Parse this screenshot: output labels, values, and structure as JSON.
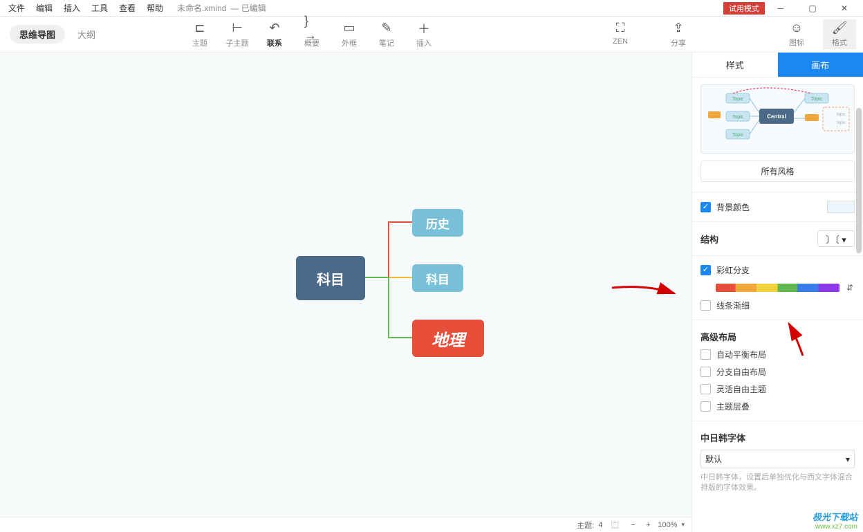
{
  "menubar": [
    "文件",
    "编辑",
    "插入",
    "工具",
    "查看",
    "帮助"
  ],
  "title": {
    "filename": "未命名.xmind",
    "status": "— 已编辑",
    "trial": "试用模式"
  },
  "viewtabs": {
    "mindmap": "思维导图",
    "outline": "大纲"
  },
  "tools": {
    "topic": "主题",
    "subtopic": "子主题",
    "relationship": "联系",
    "summary": "概要",
    "boundary": "外框",
    "note": "笔记",
    "insert": "插入",
    "zen": "ZEN",
    "share": "分享",
    "icon": "图标",
    "format": "格式"
  },
  "canvas": {
    "center": "科目",
    "children": [
      {
        "label": "历史"
      },
      {
        "label": "科目"
      },
      {
        "label": "地理"
      }
    ]
  },
  "panel": {
    "tabs": {
      "style": "样式",
      "canvas": "画布"
    },
    "preview_center": "Central",
    "preview_topic": "Topic",
    "preview_topic_small": "topic",
    "all_styles": "所有风格",
    "bg_color": "背景颜色",
    "structure": "结构",
    "rainbow": "彩虹分支",
    "line_taper": "线条渐细",
    "adv_layout": "高级布局",
    "auto_balance": "自动平衡布局",
    "free_branch": "分支自由布局",
    "flex_topic": "灵活自由主题",
    "overlap": "主题层叠",
    "cjk_font": "中日韩字体",
    "font_default": "默认",
    "cjk_desc": "中日韩字体，设置后单独优化与西文字体混合排版的字体效果。"
  },
  "status": {
    "topics_label": "主题:",
    "topics_count": "4",
    "zoom": "100%"
  },
  "watermark": {
    "name": "极光下载站",
    "url": "www.xz7.com"
  }
}
